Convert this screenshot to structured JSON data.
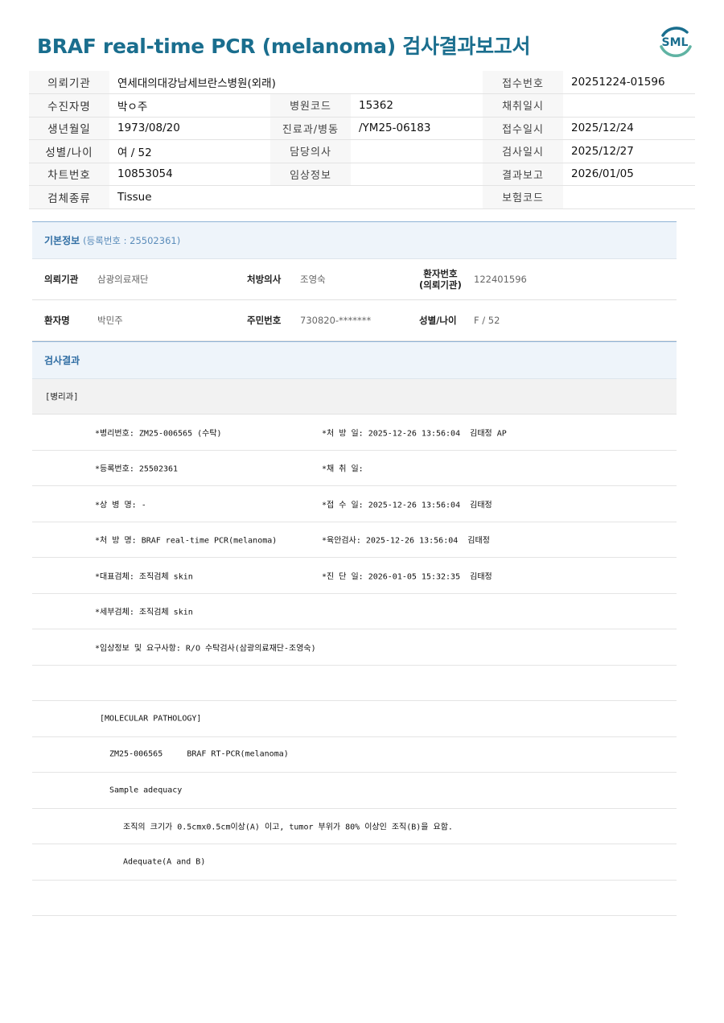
{
  "title": "BRAF real-time PCR (melanoma) 검사결과보고서",
  "logo_text": "SML",
  "colors": {
    "title": "#1a6e8e",
    "logo": "#1a6e8e",
    "logo_accent": "#5fb3a3",
    "section_bg": "#eef4fa",
    "section_border": "#8fb3d6"
  },
  "header": {
    "r1": {
      "k1": "의뢰기관",
      "v1": "연세대의대강남세브란스병원(외래)",
      "k3": "접수번호",
      "v3": "20251224-01596"
    },
    "r2": {
      "k1": "수진자명",
      "v1": "박ㅇ주",
      "k2": "병원코드",
      "v2": "15362",
      "k3": "채취일시",
      "v3": ""
    },
    "r3": {
      "k1": "생년월일",
      "v1": "1973/08/20",
      "k2": "진료과/병동",
      "v2": "/YM25-06183",
      "k3": "접수일시",
      "v3": "2025/12/24"
    },
    "r4": {
      "k1": "성별/나이",
      "v1": "여 / 52",
      "k2": "담당의사",
      "v2": "",
      "k3": "검사일시",
      "v3": "2025/12/27"
    },
    "r5": {
      "k1": "차트번호",
      "v1": "10853054",
      "k2": "임상정보",
      "v2": "",
      "k3": "결과보고",
      "v3": "2026/01/05"
    },
    "r6": {
      "k1": "검체종류",
      "v1": "Tissue",
      "k3": "보험코드",
      "v3": ""
    }
  },
  "basic": {
    "heading": "기본정보",
    "sub": "(등록번호 : 25502361)",
    "row1": {
      "l1": "의뢰기관",
      "v1": "삼광의료재단",
      "l2": "처방의사",
      "v2": "조영숙",
      "l3a": "환자번호",
      "l3b": "(의뢰기관)",
      "v3": "122401596"
    },
    "row2": {
      "l1": "환자명",
      "v1": "박민주",
      "l2": "주민번호",
      "v2": "730820-*******",
      "l3": "성별/나이",
      "v3": "F / 52"
    }
  },
  "result": {
    "heading": "검사결과",
    "dept": "[병리과]",
    "rows": [
      {
        "left": "*병리번호: ZM25-006565 (수탁)",
        "right": "*처 방 일: 2025-12-26 13:56:04  김태정 AP"
      },
      {
        "left": "*등록번호: 25502361",
        "right": "*채 취 일:"
      },
      {
        "left": "*상 병 명: -",
        "right": "*접 수 일: 2025-12-26 13:56:04  김태정"
      },
      {
        "left": "*처 방 명: BRAF real-time PCR(melanoma)",
        "right": "*육안검사: 2025-12-26 13:56:04  김태정"
      },
      {
        "left": "*대표검체: 조직검체 skin",
        "right": "*진 단 일: 2026-01-05 15:32:35  김태정"
      },
      {
        "left": "*세부검체: 조직검체 skin",
        "right": ""
      },
      {
        "left": "*임상정보 및 요구사항: R/O 수탁검사(삼광의료재단-조영숙)",
        "right": ""
      }
    ],
    "mp_title": "[MOLECULAR PATHOLOGY]",
    "mp_id": "ZM25-006565     BRAF RT-PCR(melanoma)",
    "adequacy_label": "Sample adequacy",
    "adequacy_note": "조직의 크기가 0.5cmx0.5cm이상(A) 이고, tumor 부위가 80% 이상인 조직(B)을 요함.",
    "adequacy_value": "Adequate(A and B)"
  }
}
